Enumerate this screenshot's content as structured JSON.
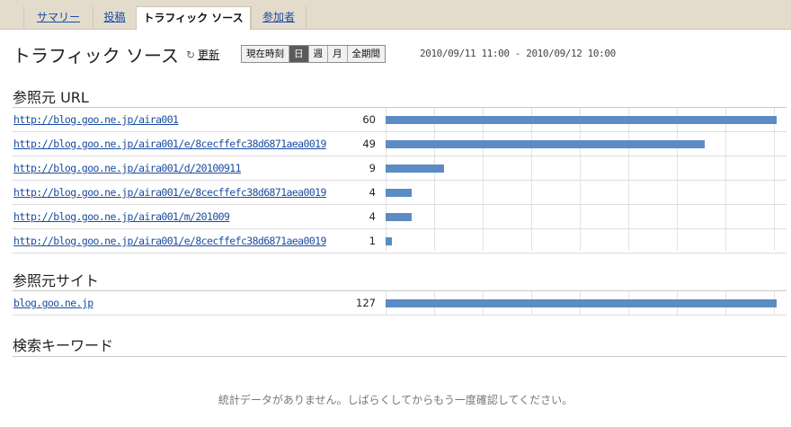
{
  "tabs": [
    {
      "label": "サマリー",
      "active": false
    },
    {
      "label": "投稿",
      "active": false
    },
    {
      "label": "トラフィック ソース",
      "active": true
    },
    {
      "label": "参加者",
      "active": false
    }
  ],
  "header": {
    "title": "トラフィック ソース",
    "refresh_label": "更新",
    "period_options": [
      "現在時刻",
      "日",
      "週",
      "月",
      "全期間"
    ],
    "period_selected": "日",
    "date_range": "2010/09/11 11:00 - 2010/09/12 10:00"
  },
  "referrer_urls": {
    "title": "参照元 URL",
    "max": 60,
    "rows": [
      {
        "url": "http://blog.goo.ne.jp/aira001",
        "count": 60
      },
      {
        "url": "http://blog.goo.ne.jp/aira001/e/8cecffefc38d6871aea0019",
        "count": 49
      },
      {
        "url": "http://blog.goo.ne.jp/aira001/d/20100911",
        "count": 9
      },
      {
        "url": "http://blog.goo.ne.jp/aira001/e/8cecffefc38d6871aea0019",
        "count": 4
      },
      {
        "url": "http://blog.goo.ne.jp/aira001/m/201009",
        "count": 4
      },
      {
        "url": "http://blog.goo.ne.jp/aira001/e/8cecffefc38d6871aea0019",
        "count": 1
      }
    ]
  },
  "referrer_sites": {
    "title": "参照元サイト",
    "max": 127,
    "rows": [
      {
        "url": "blog.goo.ne.jp",
        "count": 127
      }
    ]
  },
  "search_keywords": {
    "title": "検索キーワード",
    "empty_message": "統計データがありません。しばらくしてからもう一度確認してください。"
  },
  "colors": {
    "bar": "#5b8cc4",
    "tab_bar": "#e3dccd",
    "link": "#1a4ca0"
  }
}
